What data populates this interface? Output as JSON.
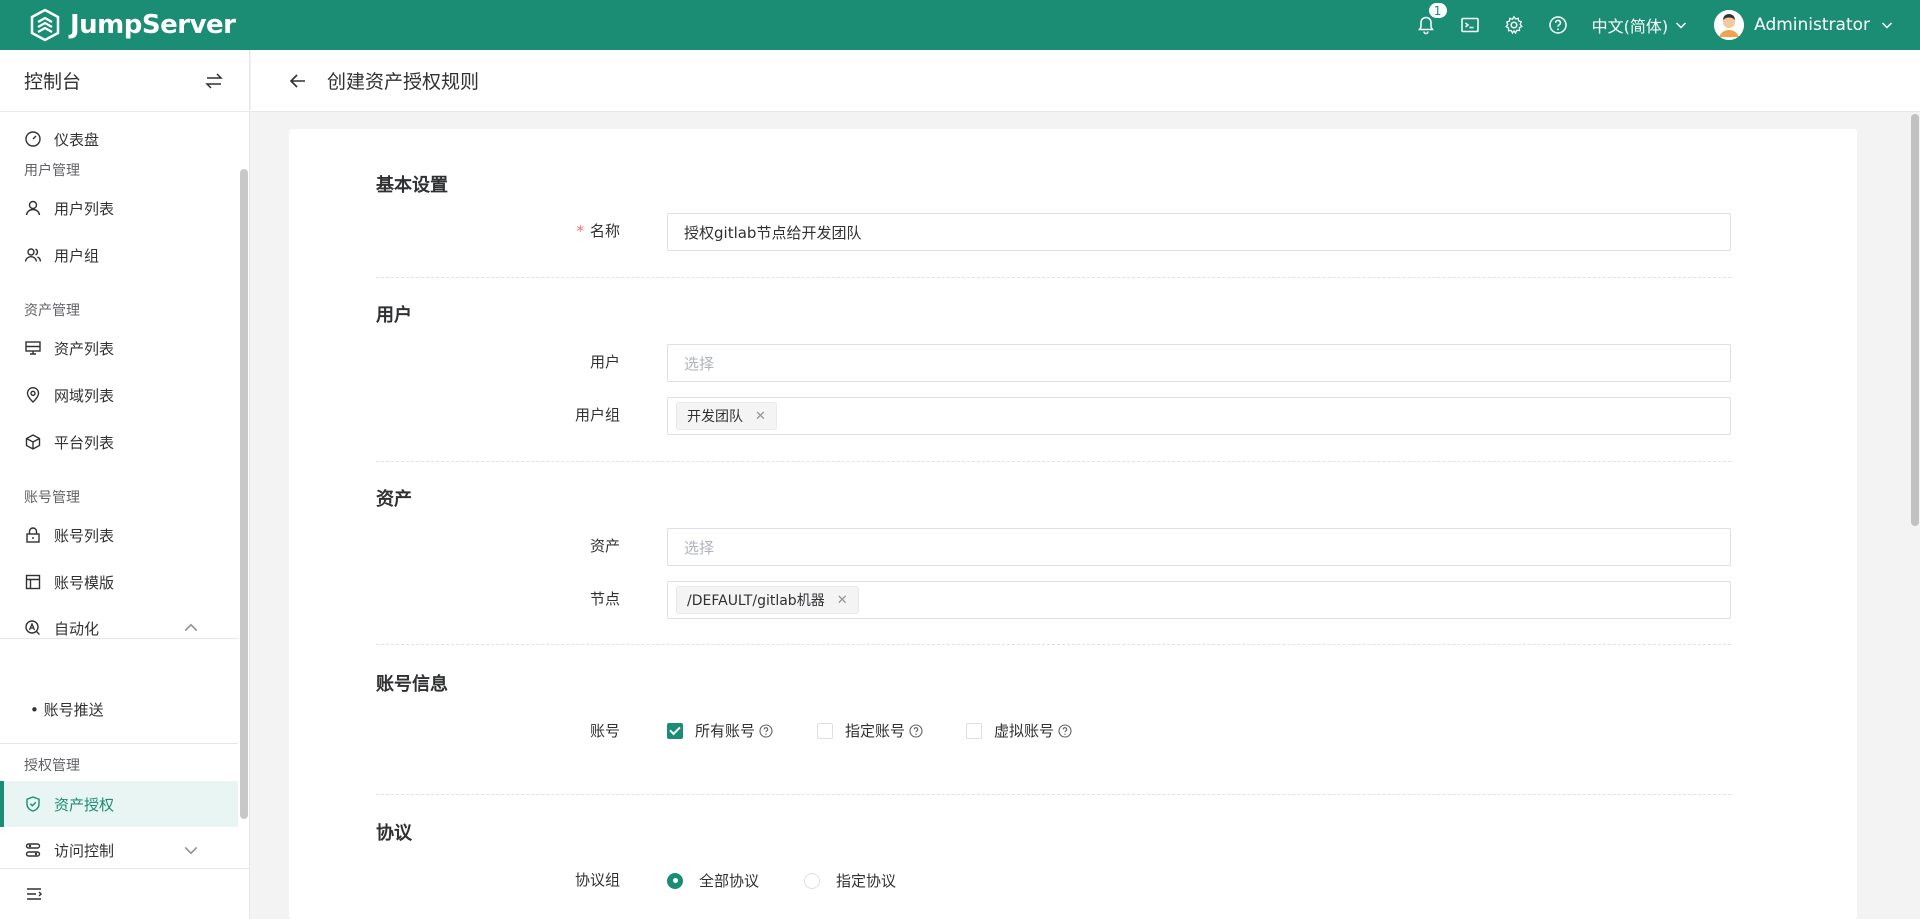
{
  "topbar": {
    "brand": "JumpServer",
    "notification_count": "1",
    "language": "中文(简体)",
    "user_name": "Administrator",
    "icons": [
      "bell-icon",
      "terminal-icon",
      "gear-icon",
      "help-icon"
    ],
    "color": "#1a8d74"
  },
  "sidebar": {
    "title": "控制台",
    "groups": {
      "user_mgmt": "用户管理",
      "asset_mgmt": "资产管理",
      "account_mgmt": "账号管理",
      "perm_mgmt": "授权管理"
    },
    "items": {
      "dashboard": "仪表盘",
      "user_list": "用户列表",
      "user_group": "用户组",
      "asset_list": "资产列表",
      "domain_list": "网域列表",
      "platform_list": "平台列表",
      "account_list": "账号列表",
      "account_template": "账号模版",
      "automation": "自动化",
      "account_push": "账号推送",
      "asset_perm": "资产授权",
      "access_control": "访问控制"
    }
  },
  "page": {
    "title": "创建资产授权规则"
  },
  "form": {
    "basic": {
      "section": "基本设置",
      "name_label": "名称",
      "name_required": "*",
      "name_value": "授权gitlab节点给开发团队"
    },
    "users": {
      "section": "用户",
      "user_label": "用户",
      "user_placeholder": "选择",
      "group_label": "用户组",
      "group_tag": "开发团队"
    },
    "assets": {
      "section": "资产",
      "asset_label": "资产",
      "asset_placeholder": "选择",
      "node_label": "节点",
      "node_tag": "/DEFAULT/gitlab机器"
    },
    "accounts": {
      "section": "账号信息",
      "label": "账号",
      "options": [
        {
          "label": "所有账号",
          "checked": true
        },
        {
          "label": "指定账号",
          "checked": false
        },
        {
          "label": "虚拟账号",
          "checked": false
        }
      ]
    },
    "protocols": {
      "section": "协议",
      "label": "协议组",
      "options": [
        {
          "label": "全部协议",
          "selected": true
        },
        {
          "label": "指定协议",
          "selected": false
        }
      ]
    }
  }
}
